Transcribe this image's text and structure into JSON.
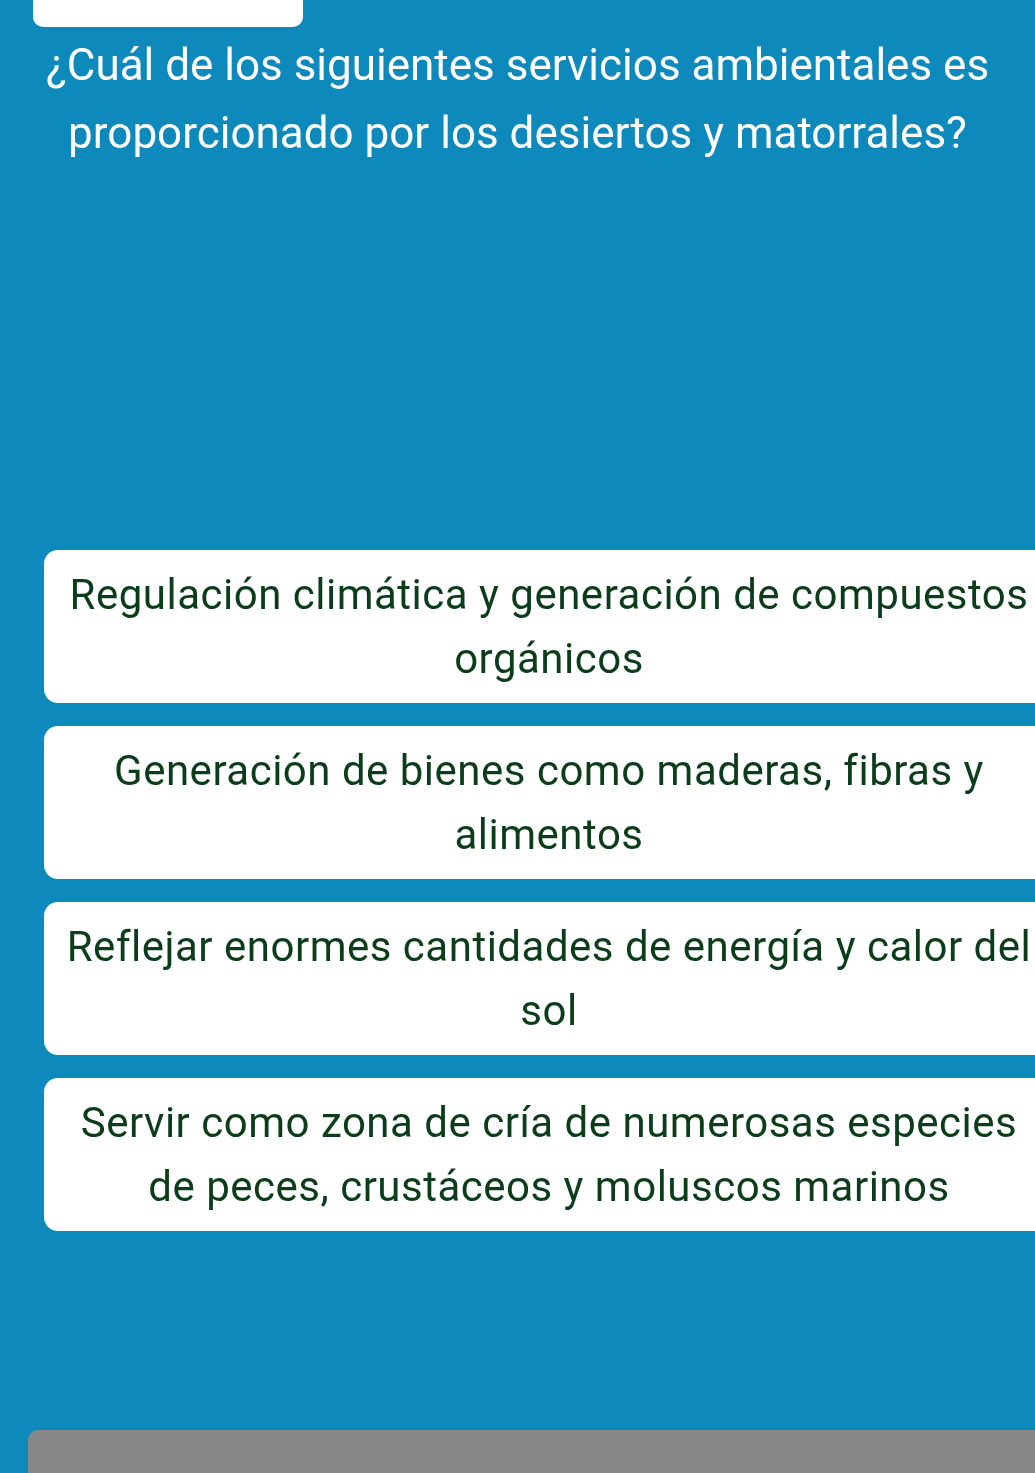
{
  "question": "¿Cuál de los siguientes servicios ambientales es proporcionado por los desiertos y matorrales?",
  "answers": [
    {
      "text": "Regulación climática y generación de compuestos orgánicos"
    },
    {
      "text": "Generación de bienes como maderas, fibras y alimentos"
    },
    {
      "text": "Reflejar enormes cantidades de energía y calor del sol"
    },
    {
      "text": "Servir como zona de cría de numerosas especies de peces, crustáceos y moluscos marinos"
    }
  ]
}
